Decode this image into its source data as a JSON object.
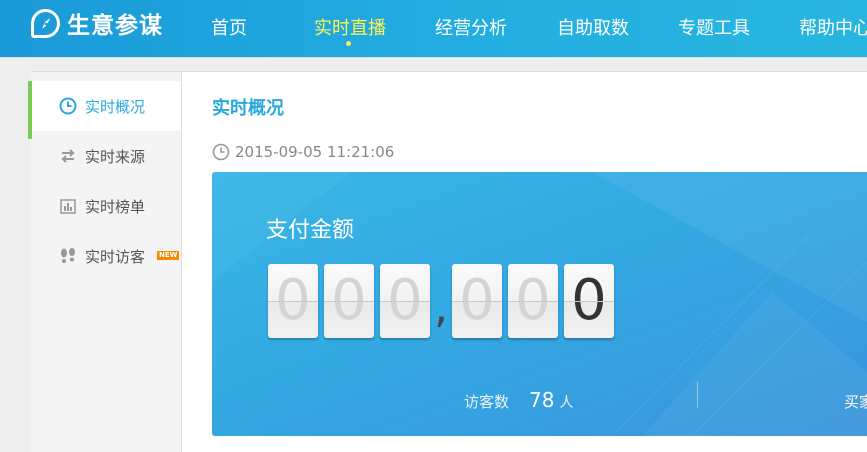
{
  "app": {
    "name": "生意参谋"
  },
  "nav": {
    "items": [
      {
        "label": "首页"
      },
      {
        "label": "实时直播"
      },
      {
        "label": "经营分析"
      },
      {
        "label": "自助取数"
      },
      {
        "label": "专题工具"
      },
      {
        "label": "帮助中心"
      }
    ],
    "active_index": 1,
    "active_color": "#fff35a"
  },
  "sidebar": {
    "items": [
      {
        "label": "实时概况",
        "icon": "clock-icon",
        "active": true
      },
      {
        "label": "实时来源",
        "icon": "swap-arrows-icon",
        "active": false
      },
      {
        "label": "实时榜单",
        "icon": "bar-chart-icon",
        "active": false
      },
      {
        "label": "实时访客",
        "icon": "footprints-icon",
        "active": false,
        "badge": "NEW"
      }
    ],
    "accent_color": "#7ccb57"
  },
  "main": {
    "title": "实时概况",
    "timestamp": "2015-09-05 11:21:06",
    "card": {
      "title": "支付金额",
      "digits": [
        "0",
        "0",
        "0",
        ",",
        "0",
        "0",
        "0"
      ],
      "visitors_label": "访客数",
      "visitors_value": "78",
      "visitors_unit": "人",
      "buyers_label": "买家"
    }
  }
}
